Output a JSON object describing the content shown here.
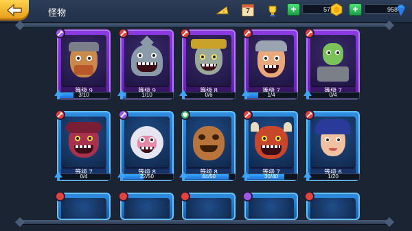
{
  "header": {
    "title": "怪物",
    "calendar_day": "7",
    "coins": "5755",
    "gems": "958"
  },
  "monsters": [
    {
      "level_label": "等级 9",
      "progress": "3/10",
      "fraction": 0.3,
      "rarity": "purple"
    },
    {
      "level_label": "等级 9",
      "progress": "1/10",
      "fraction": 0.1,
      "rarity": "purple"
    },
    {
      "level_label": "等级 8",
      "progress": "0/6",
      "fraction": 0.0,
      "rarity": "purple"
    },
    {
      "level_label": "等级 7",
      "progress": "1/4",
      "fraction": 0.25,
      "rarity": "purple"
    },
    {
      "level_label": "等级 7",
      "progress": "0/4",
      "fraction": 0.0,
      "rarity": "purple"
    },
    {
      "level_label": "等级 7",
      "progress": "0/4",
      "fraction": 0.0,
      "rarity": "blue"
    },
    {
      "level_label": "等级 8",
      "progress": "22/50",
      "fraction": 0.44,
      "rarity": "blue"
    },
    {
      "level_label": "等级 8",
      "progress": "44/50",
      "fraction": 0.88,
      "rarity": "blue"
    },
    {
      "level_label": "等级 7",
      "progress": "30/40",
      "fraction": 0.75,
      "rarity": "blue"
    },
    {
      "level_label": "等级 6",
      "progress": "1/20",
      "fraction": 0.05,
      "rarity": "blue"
    }
  ],
  "icons": {
    "back": "arrow-left-icon",
    "cheese": "cheese-icon",
    "calendar": "calendar-icon",
    "trophy": "trophy-icon",
    "coin": "coin-icon",
    "gem": "gem-icon"
  },
  "colors": {
    "accent_yellow": "#f4b324",
    "plus_green": "#2fbf5b",
    "progress_blue": "#2a8cf0"
  }
}
